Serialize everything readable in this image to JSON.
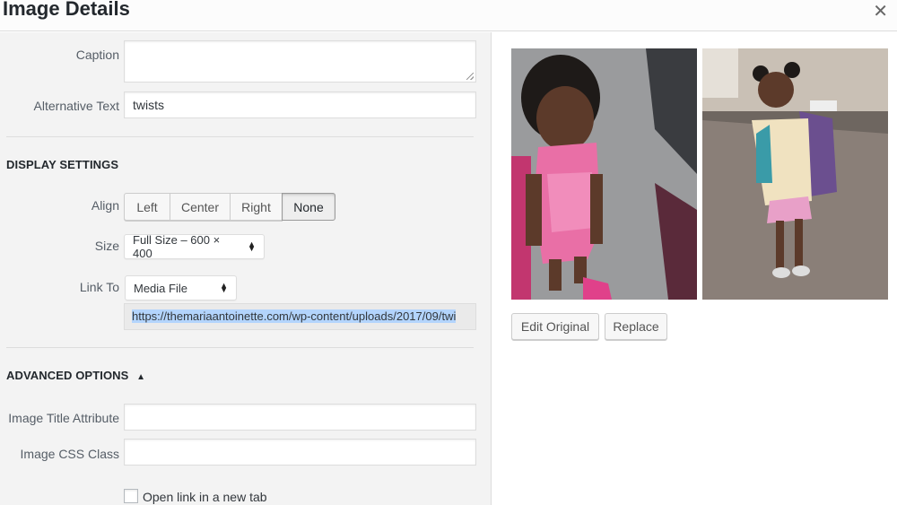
{
  "modal": {
    "title": "Image Details",
    "close_icon": "close-icon"
  },
  "fields": {
    "caption": {
      "label": "Caption",
      "value": ""
    },
    "alt_text": {
      "label": "Alternative Text",
      "value": "twists"
    }
  },
  "display_settings": {
    "title": "DISPLAY SETTINGS",
    "align": {
      "label": "Align",
      "options": [
        "Left",
        "Center",
        "Right",
        "None"
      ],
      "selected": "None"
    },
    "size": {
      "label": "Size",
      "value": "Full Size – 600 × 400"
    },
    "link_to": {
      "label": "Link To",
      "value": "Media File",
      "url": "https://themariaantoinette.com/wp-content/uploads/2017/09/twi"
    }
  },
  "advanced_options": {
    "title": "ADVANCED OPTIONS",
    "toggle_icon": "triangle-up-icon",
    "image_title": {
      "label": "Image Title Attribute",
      "value": ""
    },
    "css_class": {
      "label": "Image CSS Class",
      "value": ""
    },
    "new_tab": {
      "label": "Open link in a new tab",
      "checked": false
    }
  },
  "preview": {
    "buttons": {
      "edit": "Edit Original",
      "replace": "Replace"
    }
  },
  "colors": {
    "panel_bg": "#f3f3f3",
    "highlight": "#b3d4fc",
    "pink": "#e96fa6",
    "purple": "#6b4f8f"
  }
}
